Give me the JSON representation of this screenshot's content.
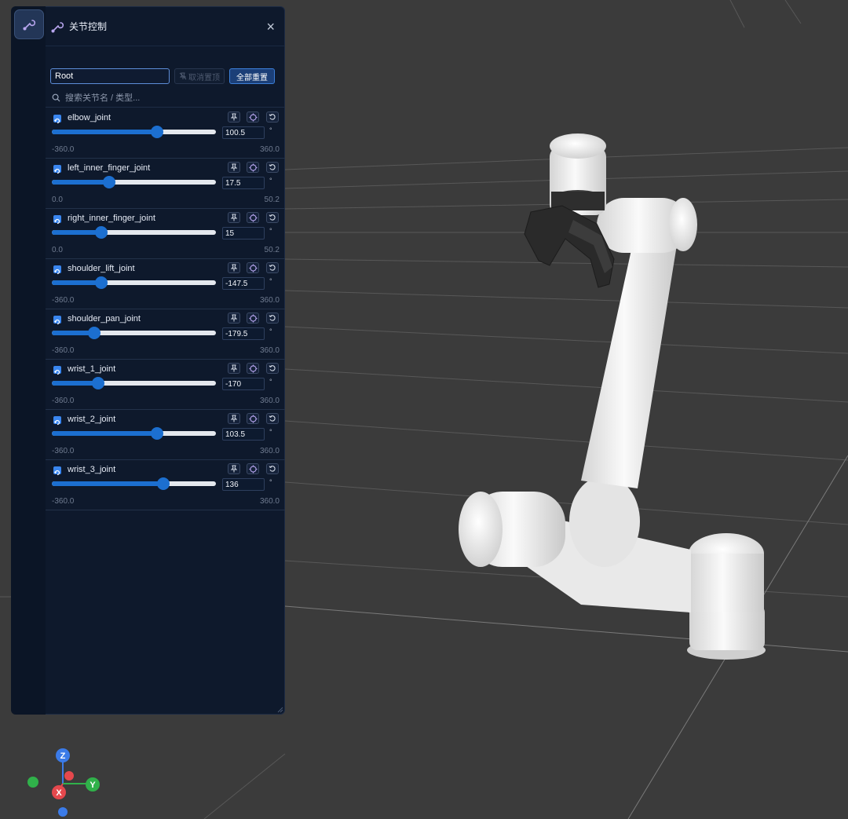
{
  "panel": {
    "title": "关节控制",
    "root_value": "Root",
    "unpin_label": "取消置顶",
    "reset_all_label": "全部重置",
    "search_placeholder": "搜索关节名 / 类型..."
  },
  "joints": [
    {
      "name": "elbow_joint",
      "value": "100.5",
      "unit": "°",
      "min": "-360.0",
      "max": "360.0",
      "level": 0.64
    },
    {
      "name": "left_inner_finger_joint",
      "value": "17.5",
      "unit": "°",
      "min": "0.0",
      "max": "50.2",
      "level": 0.35
    },
    {
      "name": "right_inner_finger_joint",
      "value": "15",
      "unit": "°",
      "min": "0.0",
      "max": "50.2",
      "level": 0.3
    },
    {
      "name": "shoulder_lift_joint",
      "value": "-147.5",
      "unit": "°",
      "min": "-360.0",
      "max": "360.0",
      "level": 0.3
    },
    {
      "name": "shoulder_pan_joint",
      "value": "-179.5",
      "unit": "°",
      "min": "-360.0",
      "max": "360.0",
      "level": 0.26
    },
    {
      "name": "wrist_1_joint",
      "value": "-170",
      "unit": "°",
      "min": "-360.0",
      "max": "360.0",
      "level": 0.28
    },
    {
      "name": "wrist_2_joint",
      "value": "103.5",
      "unit": "°",
      "min": "-360.0",
      "max": "360.0",
      "level": 0.64
    },
    {
      "name": "wrist_3_joint",
      "value": "136",
      "unit": "°",
      "min": "-360.0",
      "max": "360.0",
      "level": 0.68
    }
  ],
  "axes_gizmo": {
    "z": "Z",
    "x": "X",
    "y": "Y"
  },
  "colors": {
    "accent": "#1c6fd0",
    "panel_bg": "#0e192c",
    "viewport_bg": "#3b3b3b",
    "axis_x": "#e5484d",
    "axis_y": "#30b14a",
    "axis_z": "#3b7be8"
  },
  "icons": {
    "rail": "wrench-icon",
    "title": "wrench-icon",
    "close": "close-icon",
    "search": "search-icon",
    "unpin": "pin-off-icon",
    "joint_type": "revolute-joint-icon",
    "pin": "pin-icon",
    "focus": "target-icon",
    "reset": "reset-icon"
  }
}
